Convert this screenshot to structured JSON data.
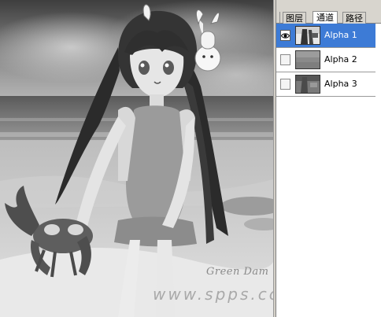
{
  "canvas": {
    "signature": "Green Dam",
    "watermark": "www.spps.cc"
  },
  "panel": {
    "tabs": [
      {
        "label": "图层",
        "active": false
      },
      {
        "label": "通道",
        "active": true
      },
      {
        "label": "路径",
        "active": false
      }
    ],
    "channels": [
      {
        "label": "Alpha 1",
        "visible": true,
        "selected": true
      },
      {
        "label": "Alpha 2",
        "visible": false,
        "selected": false
      },
      {
        "label": "Alpha 3",
        "visible": false,
        "selected": false
      }
    ]
  },
  "colors": {
    "selection": "#3d7bd6",
    "panel_bg": "#d8d5ce"
  },
  "icons": {
    "visibility": "eye-icon"
  }
}
